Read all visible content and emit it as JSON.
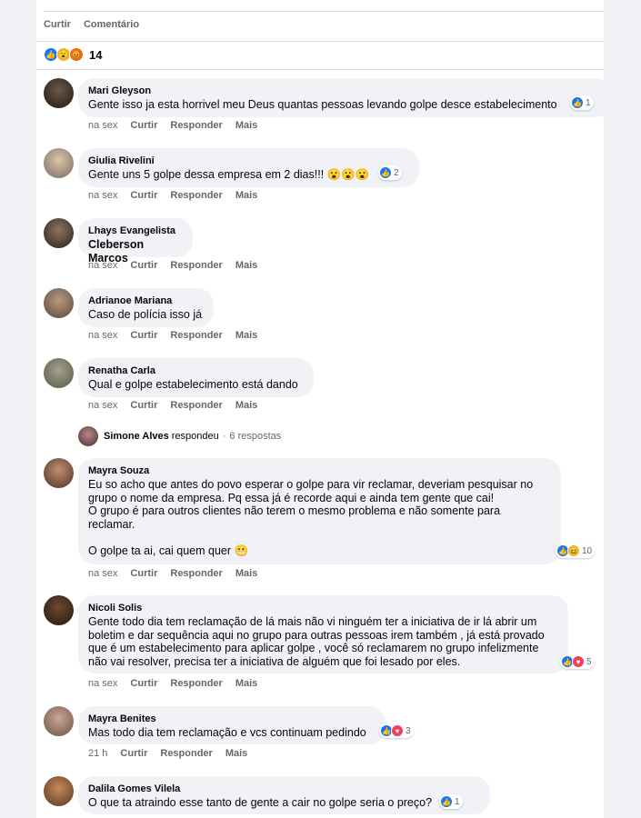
{
  "post_actions": {
    "like": "Curtir",
    "comment": "Comentário"
  },
  "reactions": {
    "count": "14",
    "icons": [
      "like-icon",
      "wow-icon",
      "angry-icon"
    ]
  },
  "meta_labels": {
    "time": "na sex",
    "like": "Curtir",
    "reply": "Responder",
    "more": "Mais"
  },
  "comments": [
    {
      "name": "Mari Gleyson",
      "text": "Gente isso ja esta horrivel meu Deus quantas pessoas levando golpe desce estabelecimento",
      "reaction_count": "1",
      "time": "na sex"
    },
    {
      "name": "Giulia Rivelini",
      "text": "Gente uns 5 golpe dessa empresa em 2 dias!!! 😮😮😮",
      "reaction_count": "2",
      "time": "na sex"
    },
    {
      "name": "Lhays Evangelista",
      "text": "Cleberson Marcos",
      "time": "na sex"
    },
    {
      "name": "Adrianoe Mariana",
      "text": "Caso de polícia isso já",
      "time": "na sex"
    },
    {
      "name": "Renatha Carla",
      "text": "Qual e golpe estabelecimento está dando",
      "time": "na sex"
    },
    {
      "name": "Mayra Souza",
      "text": "Eu so acho que antes do povo esperar o golpe para vir reclamar, deveriam pesquisar no\ngrupo o nome da empresa. Pq essa já é recorde aqui e ainda tem gente que cai!\nO grupo é para outros clientes não terem o mesmo problema e não somente para\nreclamar.\n\nO golpe ta ai, cai quem quer 😬",
      "reaction_count": "10",
      "time": "na sex"
    },
    {
      "name": "Nicoli Solis",
      "text": "Gente todo dia tem reclamação de lá mais não vi ninguém ter a iniciativa de ir lá abrir um\nboletim e dar sequência aqui no grupo para outras pessoas irem também , já está provado\nque é um estabelecimento para aplicar golpe , você só reclamarem no grupo infelizmente\nnão vai resolver, precisa ter a iniciativa de alguém que foi lesado por eles.",
      "reaction_count": "5",
      "time": "na sex"
    },
    {
      "name": "Mayra Benites",
      "text": "Mas todo dia tem reclamação e vcs continuam pedindo",
      "reaction_count": "3",
      "time": "21 h"
    },
    {
      "name": "Dalila Gomes Vilela",
      "text": "O que ta atraindo esse tanto de gente a cair no golpe seria o preço?",
      "reaction_count": "1",
      "time": ""
    }
  ],
  "reply_thread": {
    "name": "Simone Alves",
    "action": "respondeu",
    "separator": "·",
    "count": "6 respostas"
  },
  "colors": {
    "like": "#1877f2",
    "love": "#f33e58",
    "bubble": "#f0f2f5",
    "meta": "#65676b"
  }
}
